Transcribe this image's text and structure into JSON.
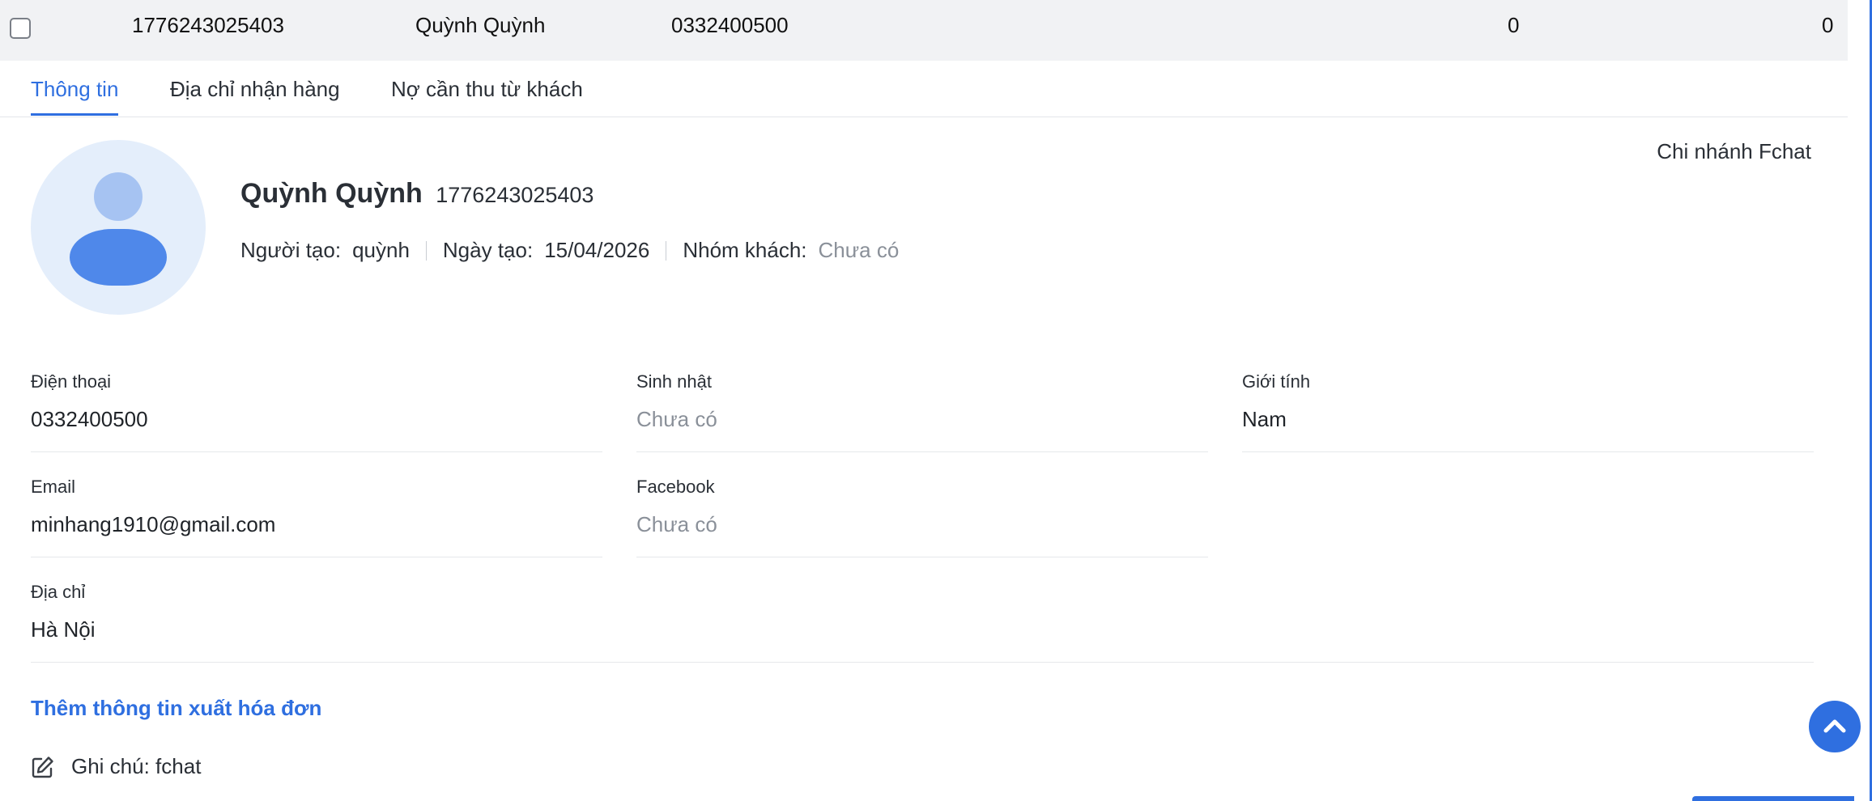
{
  "row": {
    "code": "1776243025403",
    "name": "Quỳnh Quỳnh",
    "phone": "0332400500",
    "col_a": "0",
    "col_b": "0"
  },
  "tabs": [
    {
      "label": "Thông tin",
      "active": true
    },
    {
      "label": "Địa chỉ nhận hàng",
      "active": false
    },
    {
      "label": "Nợ cần thu từ khách",
      "active": false
    }
  ],
  "profile": {
    "name": "Quỳnh Quỳnh",
    "code": "1776243025403",
    "branch": "Chi nhánh Fchat",
    "creator_label": "Người tạo:",
    "creator_value": "quỳnh",
    "created_label": "Ngày tạo:",
    "created_value": "15/04/2026",
    "group_label": "Nhóm khách:",
    "group_value": "Chưa có"
  },
  "fields": {
    "phone": {
      "label": "Điện thoại",
      "value": "0332400500"
    },
    "birthday": {
      "label": "Sinh nhật",
      "value": "Chưa có"
    },
    "gender": {
      "label": "Giới tính",
      "value": "Nam"
    },
    "email": {
      "label": "Email",
      "value": "minhang1910@gmail.com"
    },
    "facebook": {
      "label": "Facebook",
      "value": "Chưa có"
    },
    "address": {
      "label": "Địa chỉ",
      "value": "Hà Nội"
    }
  },
  "invoice_link": "Thêm thông tin xuất hóa đơn",
  "note": "Ghi chú: fchat",
  "icons": {
    "note": "edit-icon",
    "scroll": "chevron-up-icon",
    "avatar": "user-avatar-icon"
  },
  "colors": {
    "accent": "#2f6fe0",
    "muted": "#8a9099",
    "row_bg": "#f1f2f4"
  }
}
